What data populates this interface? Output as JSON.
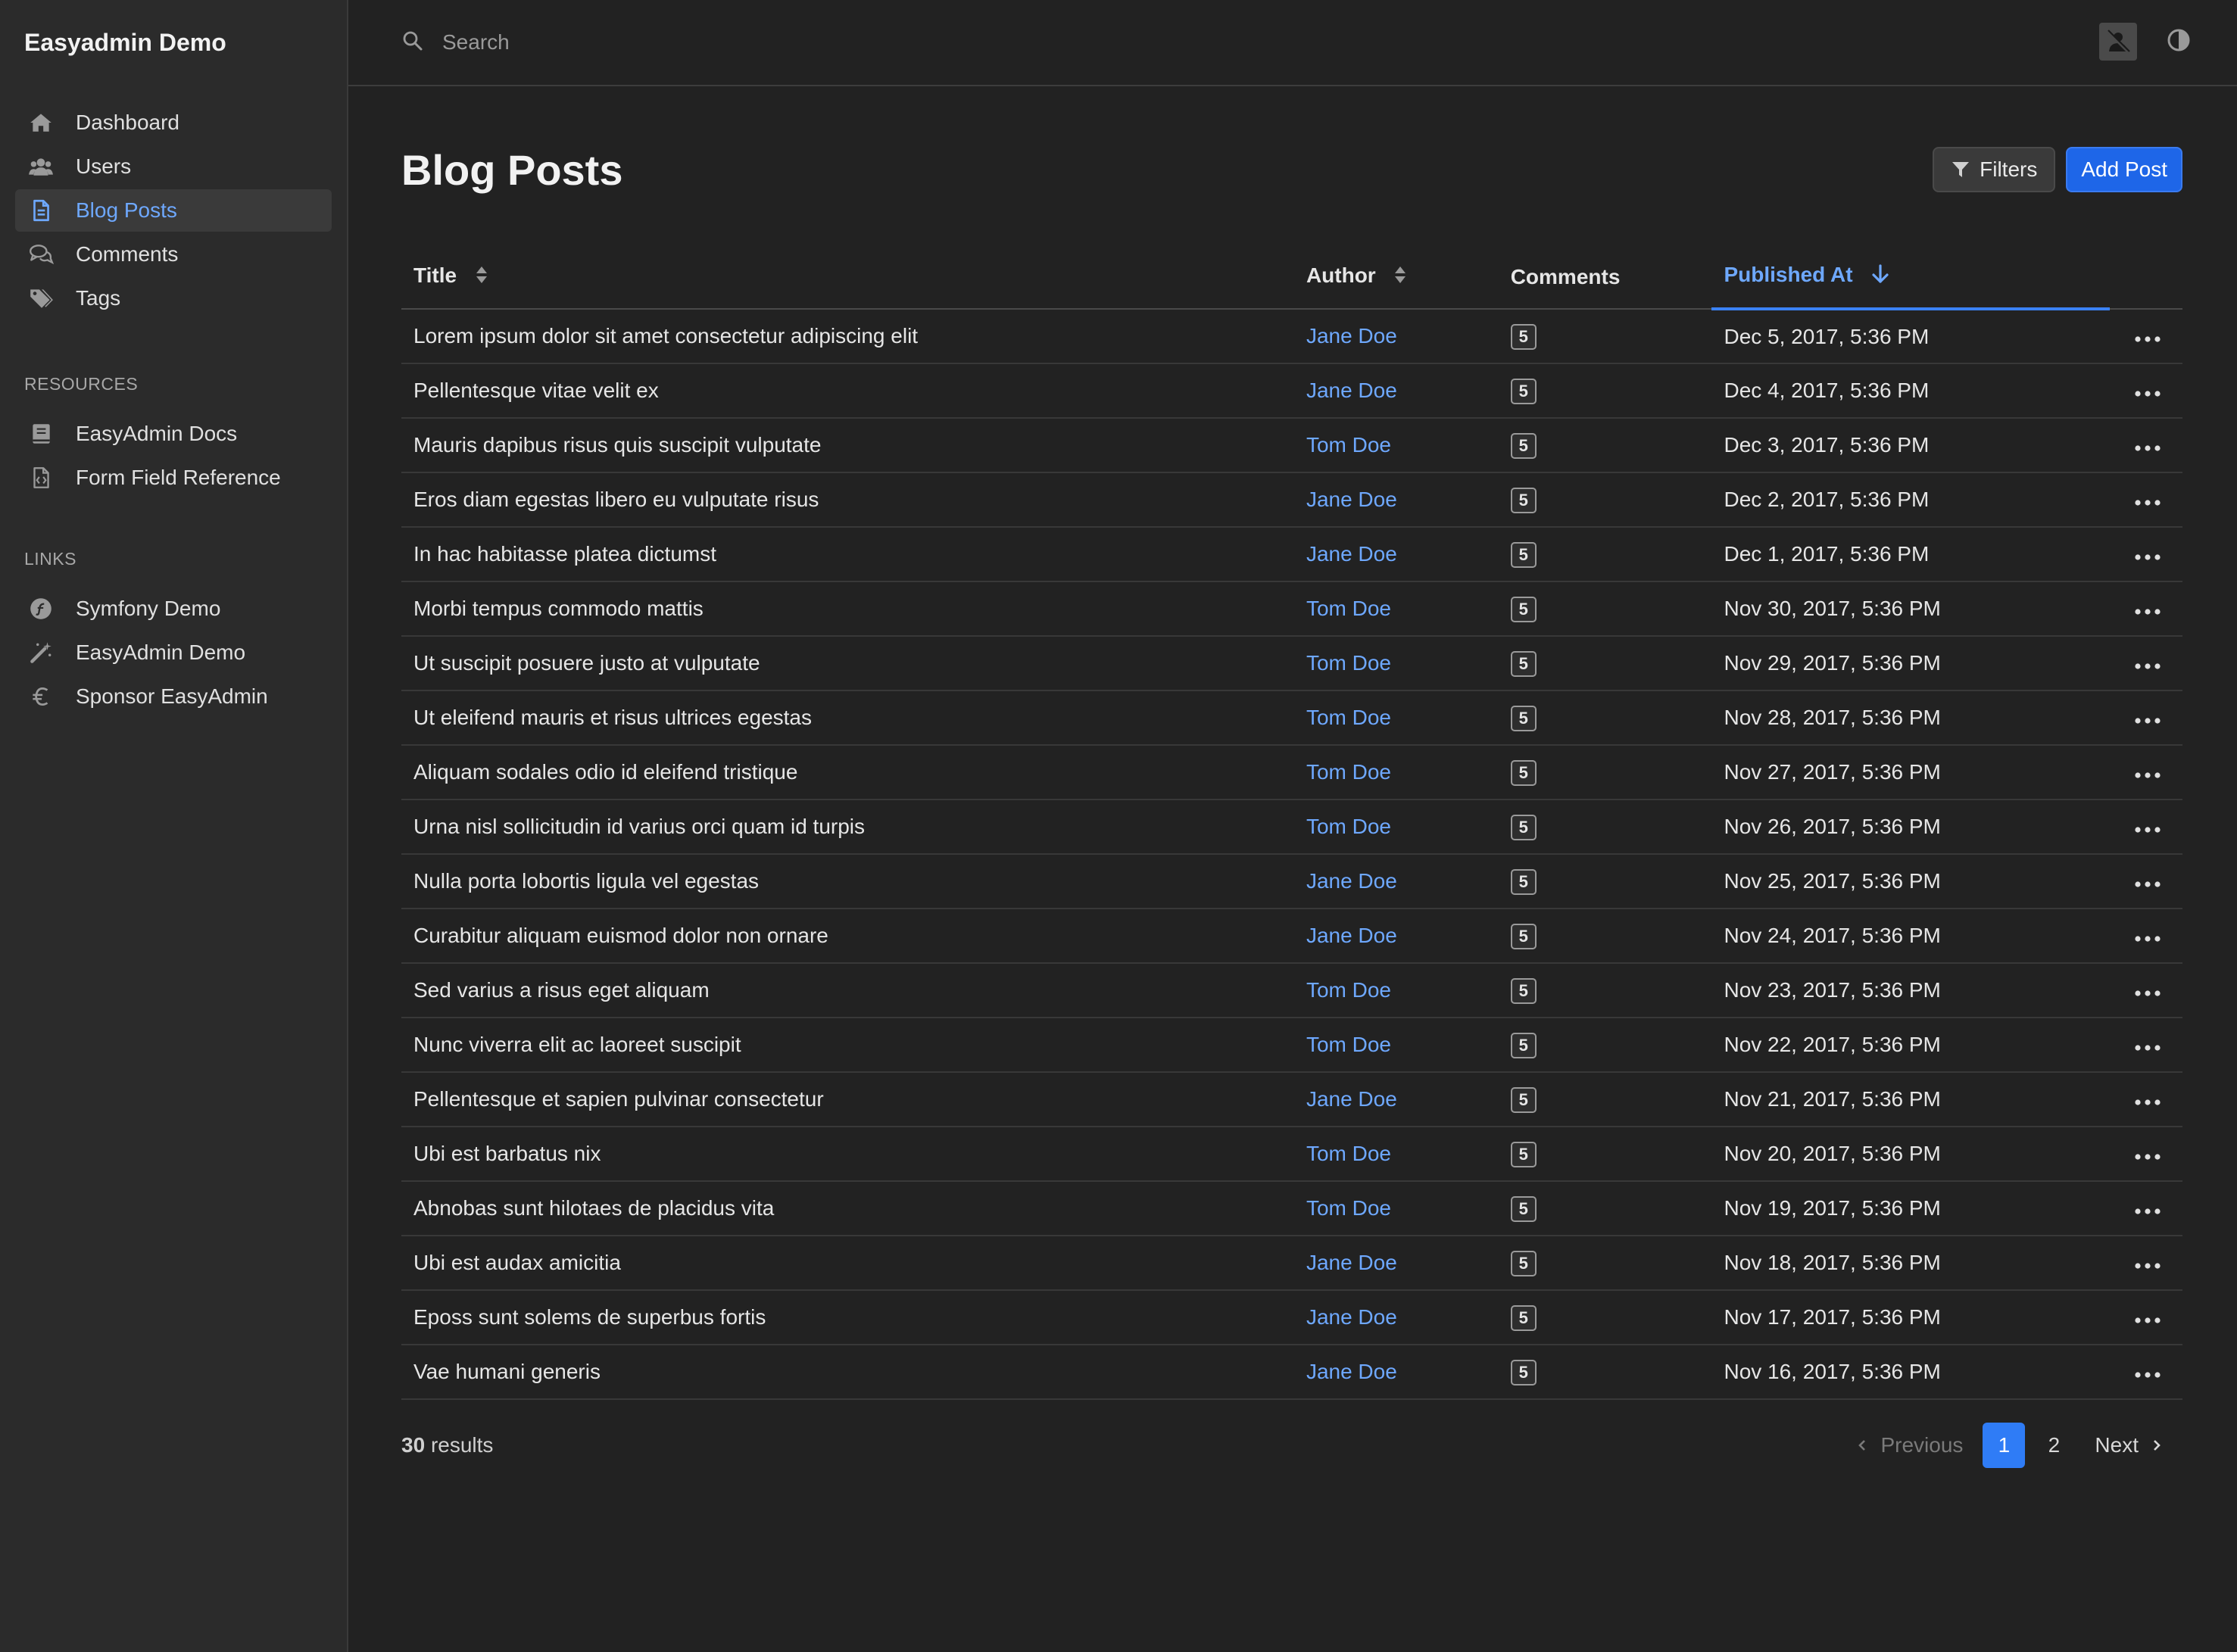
{
  "sidebar": {
    "brand": "Easyadmin Demo",
    "menu": [
      {
        "label": "Dashboard",
        "icon": "home-icon"
      },
      {
        "label": "Users",
        "icon": "users-icon"
      },
      {
        "label": "Blog Posts",
        "icon": "file-icon",
        "active": true
      },
      {
        "label": "Comments",
        "icon": "comments-icon"
      },
      {
        "label": "Tags",
        "icon": "tags-icon"
      }
    ],
    "resources_label": "RESOURCES",
    "resources": [
      {
        "label": "EasyAdmin Docs",
        "icon": "book-icon"
      },
      {
        "label": "Form Field Reference",
        "icon": "file-code-icon"
      }
    ],
    "links_label": "LINKS",
    "links": [
      {
        "label": "Symfony Demo",
        "icon": "symfony-icon"
      },
      {
        "label": "EasyAdmin Demo",
        "icon": "magic-wand-icon"
      },
      {
        "label": "Sponsor EasyAdmin",
        "icon": "euro-icon"
      }
    ]
  },
  "topbar": {
    "search_placeholder": "Search"
  },
  "page": {
    "title": "Blog Posts",
    "filters_label": "Filters",
    "add_label": "Add Post"
  },
  "table": {
    "columns": {
      "title": "Title",
      "author": "Author",
      "comments": "Comments",
      "published": "Published At"
    },
    "rows": [
      {
        "title": "Lorem ipsum dolor sit amet consectetur adipiscing elit",
        "author": "Jane Doe",
        "comments": "5",
        "published": "Dec 5, 2017, 5:36 PM"
      },
      {
        "title": "Pellentesque vitae velit ex",
        "author": "Jane Doe",
        "comments": "5",
        "published": "Dec 4, 2017, 5:36 PM"
      },
      {
        "title": "Mauris dapibus risus quis suscipit vulputate",
        "author": "Tom Doe",
        "comments": "5",
        "published": "Dec 3, 2017, 5:36 PM"
      },
      {
        "title": "Eros diam egestas libero eu vulputate risus",
        "author": "Jane Doe",
        "comments": "5",
        "published": "Dec 2, 2017, 5:36 PM"
      },
      {
        "title": "In hac habitasse platea dictumst",
        "author": "Jane Doe",
        "comments": "5",
        "published": "Dec 1, 2017, 5:36 PM"
      },
      {
        "title": "Morbi tempus commodo mattis",
        "author": "Tom Doe",
        "comments": "5",
        "published": "Nov 30, 2017, 5:36 PM"
      },
      {
        "title": "Ut suscipit posuere justo at vulputate",
        "author": "Tom Doe",
        "comments": "5",
        "published": "Nov 29, 2017, 5:36 PM"
      },
      {
        "title": "Ut eleifend mauris et risus ultrices egestas",
        "author": "Tom Doe",
        "comments": "5",
        "published": "Nov 28, 2017, 5:36 PM"
      },
      {
        "title": "Aliquam sodales odio id eleifend tristique",
        "author": "Tom Doe",
        "comments": "5",
        "published": "Nov 27, 2017, 5:36 PM"
      },
      {
        "title": "Urna nisl sollicitudin id varius orci quam id turpis",
        "author": "Tom Doe",
        "comments": "5",
        "published": "Nov 26, 2017, 5:36 PM"
      },
      {
        "title": "Nulla porta lobortis ligula vel egestas",
        "author": "Jane Doe",
        "comments": "5",
        "published": "Nov 25, 2017, 5:36 PM"
      },
      {
        "title": "Curabitur aliquam euismod dolor non ornare",
        "author": "Jane Doe",
        "comments": "5",
        "published": "Nov 24, 2017, 5:36 PM"
      },
      {
        "title": "Sed varius a risus eget aliquam",
        "author": "Tom Doe",
        "comments": "5",
        "published": "Nov 23, 2017, 5:36 PM"
      },
      {
        "title": "Nunc viverra elit ac laoreet suscipit",
        "author": "Tom Doe",
        "comments": "5",
        "published": "Nov 22, 2017, 5:36 PM"
      },
      {
        "title": "Pellentesque et sapien pulvinar consectetur",
        "author": "Jane Doe",
        "comments": "5",
        "published": "Nov 21, 2017, 5:36 PM"
      },
      {
        "title": "Ubi est barbatus nix",
        "author": "Tom Doe",
        "comments": "5",
        "published": "Nov 20, 2017, 5:36 PM"
      },
      {
        "title": "Abnobas sunt hilotaes de placidus vita",
        "author": "Tom Doe",
        "comments": "5",
        "published": "Nov 19, 2017, 5:36 PM"
      },
      {
        "title": "Ubi est audax amicitia",
        "author": "Jane Doe",
        "comments": "5",
        "published": "Nov 18, 2017, 5:36 PM"
      },
      {
        "title": "Eposs sunt solems de superbus fortis",
        "author": "Jane Doe",
        "comments": "5",
        "published": "Nov 17, 2017, 5:36 PM"
      },
      {
        "title": "Vae humani generis",
        "author": "Jane Doe",
        "comments": "5",
        "published": "Nov 16, 2017, 5:36 PM"
      }
    ]
  },
  "footer": {
    "results_count": "30",
    "results_label": "results",
    "prev_label": "Previous",
    "pages": [
      "1",
      "2"
    ],
    "current_page": "1",
    "next_label": "Next"
  },
  "colors": {
    "background": "#222222",
    "sidebar": "#2b2b2b",
    "accent": "#6ea8fe",
    "primary_button": "#1e66e8"
  }
}
